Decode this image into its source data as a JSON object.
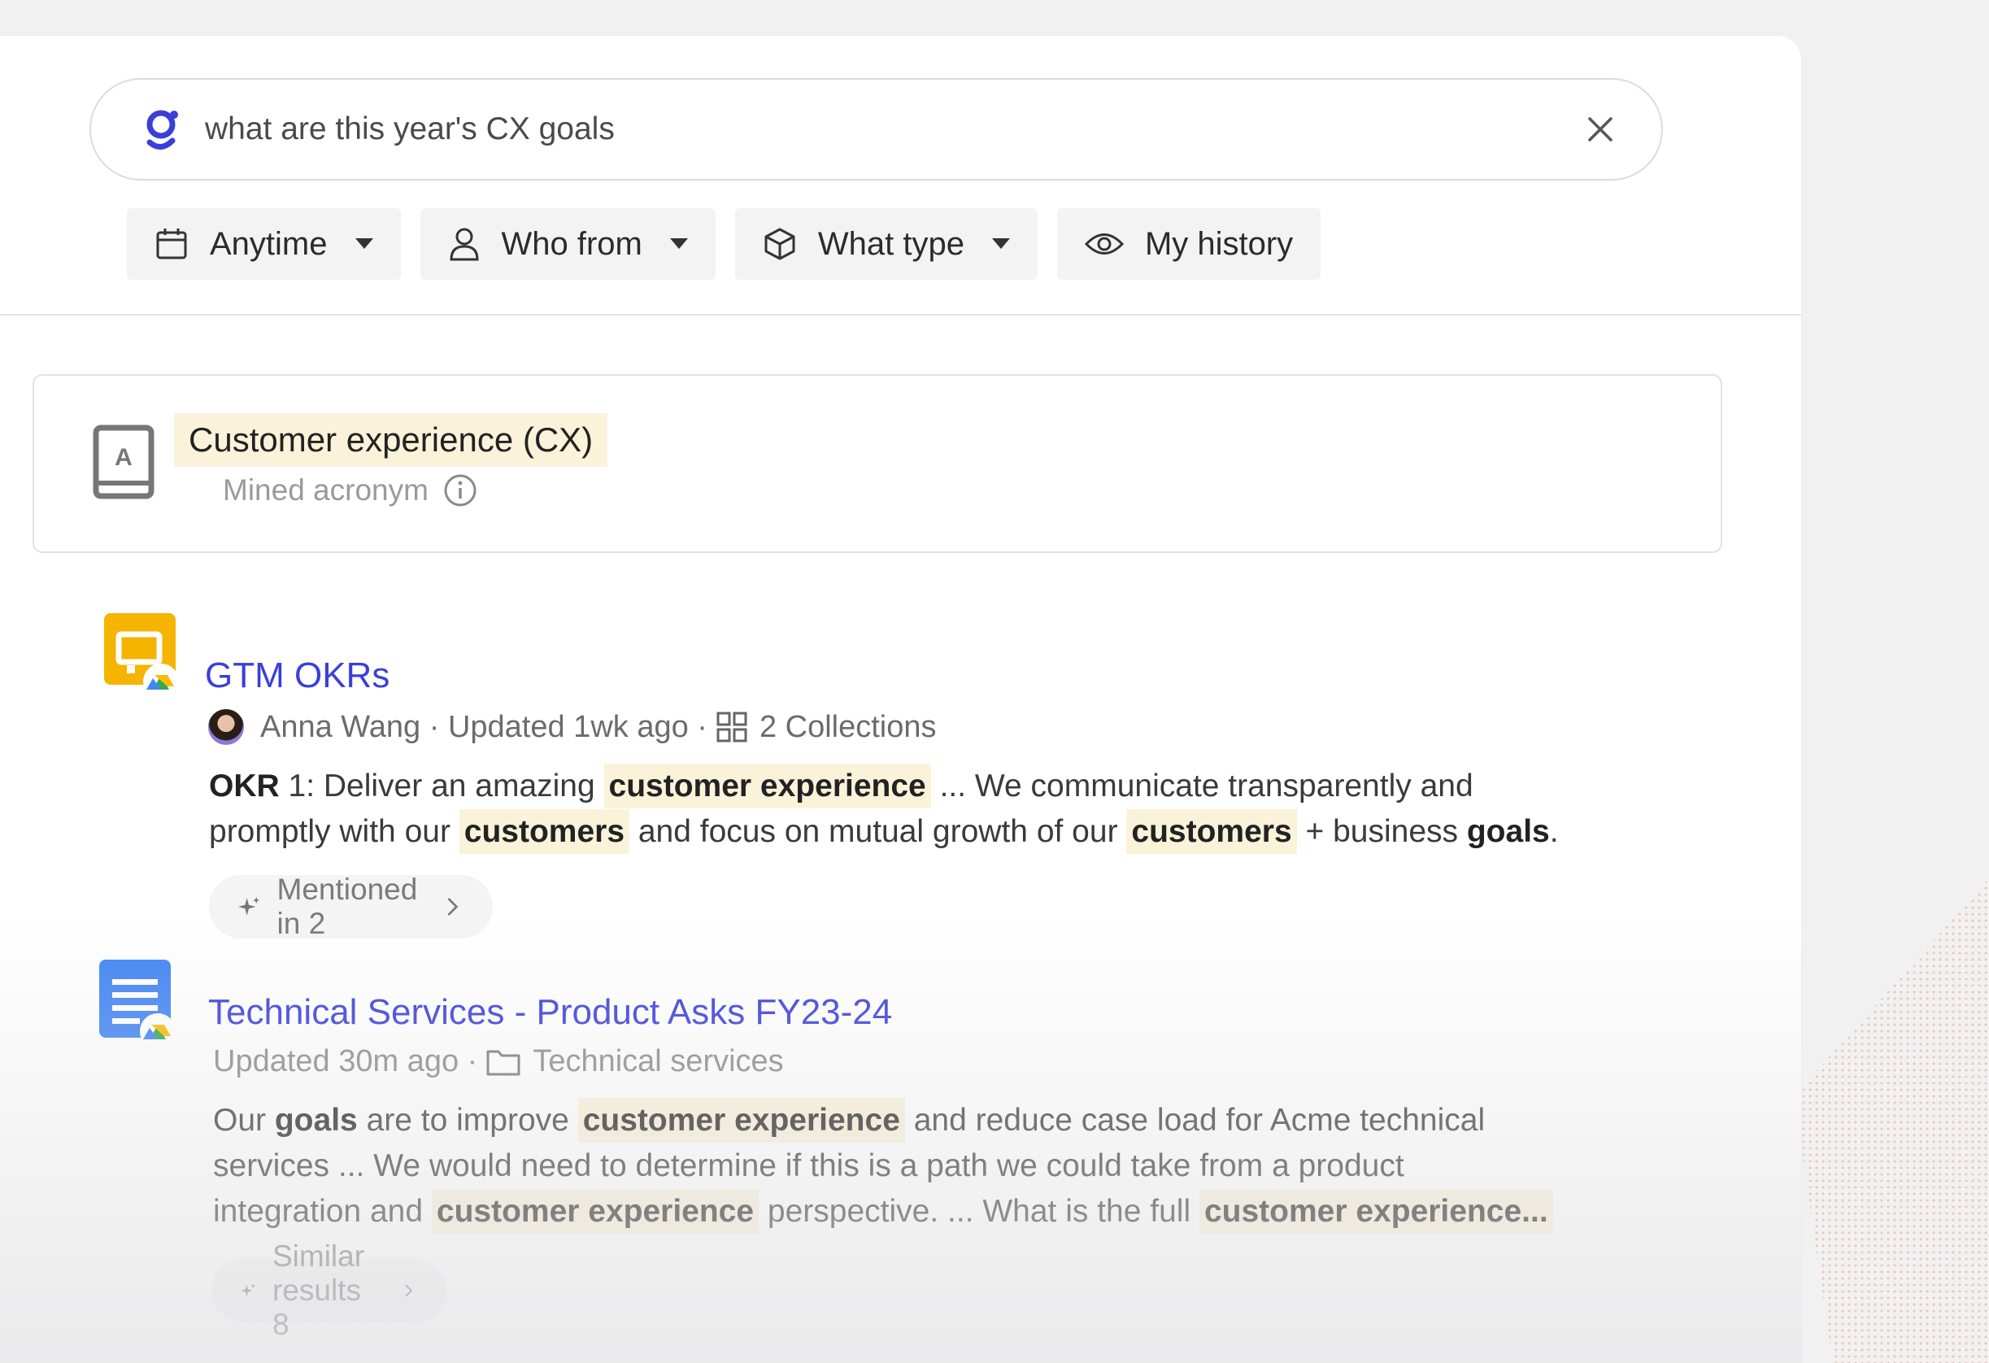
{
  "search": {
    "query": "what are this year's CX goals",
    "icons": {
      "logo": "glean-logo-icon",
      "clear": "close-icon"
    }
  },
  "filters": [
    {
      "label": "Anytime",
      "icon": "calendar-icon",
      "has_caret": true
    },
    {
      "label": "Who from",
      "icon": "person-icon",
      "has_caret": true
    },
    {
      "label": "What type",
      "icon": "cube-icon",
      "has_caret": true
    },
    {
      "label": "My history",
      "icon": "eye-icon",
      "has_caret": false
    }
  ],
  "acronym": {
    "title": "Customer experience (CX)",
    "subtitle": "Mined acronym",
    "icon": "book-icon"
  },
  "results": [
    {
      "title": "GTM OKRs",
      "icon": "google-slides-icon",
      "author": "Anna Wang",
      "updated": "Updated 1wk ago",
      "collections": "2 Collections",
      "snippet": {
        "p1": "OKR",
        "p2": " 1: Deliver an amazing ",
        "p3": "customer experience",
        "p4": " ... We communicate transparently and",
        "p5": "promptly with our ",
        "p6": "customers",
        "p7": " and focus on mutual growth of our ",
        "p8": "customers",
        "p9": " + business ",
        "p10": "goals",
        "p11": "."
      },
      "pill": "Mentioned in 2"
    },
    {
      "title": "Technical Services - Product Asks FY23-24",
      "icon": "google-docs-icon",
      "updated": "Updated 30m ago",
      "folder": "Technical services",
      "snippet": {
        "p1": "Our ",
        "p2": "goals",
        "p3": " are to improve ",
        "p4": "customer experience",
        "p5": " and reduce case load for Acme technical",
        "p6": "services ... We would need to determine if this is a path we could take from a product",
        "p7": "integration and ",
        "p8": "customer experience",
        "p9": " perspective. ... What is the full ",
        "p10": "customer experience..."
      },
      "pill": "Similar results 8"
    }
  ],
  "colors": {
    "link": "#3b3fd8",
    "highlight": "#fbf2da",
    "accent_deco": "#e7b9a1"
  }
}
